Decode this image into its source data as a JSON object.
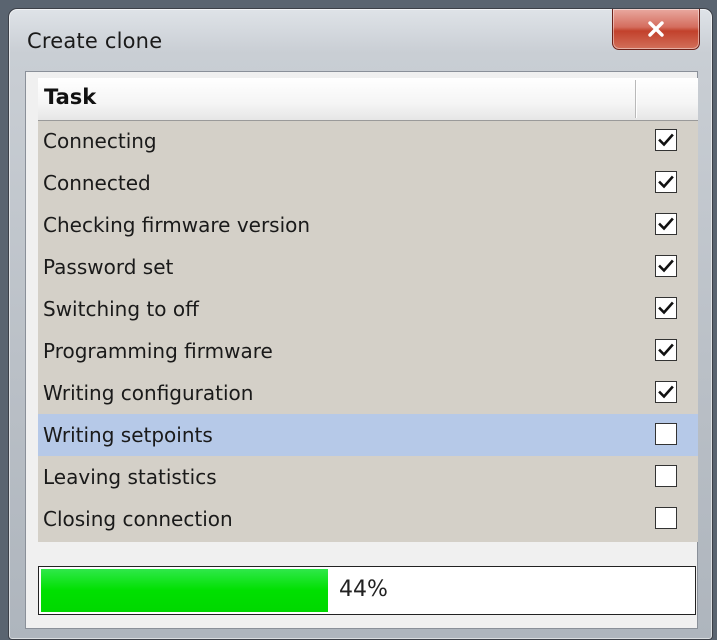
{
  "window": {
    "title": "Create clone",
    "close_icon": "close-icon"
  },
  "table": {
    "header": {
      "task": "Task"
    },
    "rows": [
      {
        "label": "Connecting",
        "checked": true,
        "selected": false
      },
      {
        "label": "Connected",
        "checked": true,
        "selected": false
      },
      {
        "label": "Checking firmware version",
        "checked": true,
        "selected": false
      },
      {
        "label": "Password set",
        "checked": true,
        "selected": false
      },
      {
        "label": "Switching to off",
        "checked": true,
        "selected": false
      },
      {
        "label": "Programming firmware",
        "checked": true,
        "selected": false
      },
      {
        "label": "Writing configuration",
        "checked": true,
        "selected": false
      },
      {
        "label": "Writing setpoints",
        "checked": false,
        "selected": true
      },
      {
        "label": "Leaving statistics",
        "checked": false,
        "selected": false
      },
      {
        "label": "Closing connection",
        "checked": false,
        "selected": false
      }
    ]
  },
  "progress": {
    "value": 0.44,
    "label": "44%",
    "color": "#00e000"
  },
  "colors": {
    "selection": "#b6c9e8",
    "grid_background": "#d4d0c8"
  }
}
